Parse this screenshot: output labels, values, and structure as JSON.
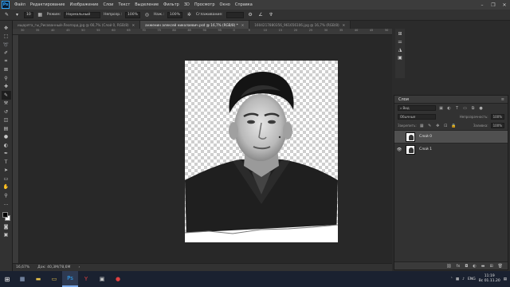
{
  "menu": {
    "logo": "Ps",
    "items": [
      "Файл",
      "Редактирование",
      "Изображение",
      "Слои",
      "Текст",
      "Выделение",
      "Фильтр",
      "3D",
      "Просмотр",
      "Окно",
      "Справка"
    ]
  },
  "options": {
    "brush_size": "10",
    "mode_label": "Режим:",
    "mode_value": "Нормальный",
    "opacity_label": "Непрозр.:",
    "opacity_value": "100%",
    "flow_label": "Наж.:",
    "flow_value": "100%",
    "smoothing_label": "Сглаживание:"
  },
  "tabs": [
    {
      "label": "ищарята_гы_Рисованный-Леопард.jpg @ 66,7% (Слой 0, RGB/8)",
      "active": false
    },
    {
      "label": "анженин алексей николаевич.psd @ 16,7% (RGB/8) *",
      "active": true
    },
    {
      "label": "1604217880356_961656106.jpg @ 16,7% (RGB/8)",
      "active": false
    }
  ],
  "ruler_marks": [
    "30",
    "35",
    "40",
    "45",
    "50",
    "55",
    "60",
    "65",
    "70",
    "75",
    "80",
    "85",
    "90",
    "95",
    "0",
    "5",
    "10",
    "15",
    "20",
    "25",
    "30",
    "35",
    "40",
    "45",
    "50"
  ],
  "status": {
    "zoom": "16,67%",
    "doc_size": "Док: 40,3M/78,6M"
  },
  "layers_panel": {
    "title": "Слои",
    "filter_kind": "Вид",
    "blend_mode": "Обычные",
    "opacity_label": "Непрозрачность:",
    "opacity_value": "100%",
    "lock_label": "Закрепить:",
    "fill_label": "Заливка:",
    "fill_value": "100%",
    "layers": [
      {
        "name": "Слой 0",
        "visible": false,
        "selected": true
      },
      {
        "name": "Слой 1",
        "visible": true,
        "selected": false
      }
    ]
  },
  "taskbar": {
    "lang": "ENG",
    "time": "11:19",
    "date": "Вс 01.11.20"
  },
  "colors": {
    "accent": "#31a8ff",
    "ui_dark": "#282828",
    "panel": "#323232",
    "selected_layer": "#505050"
  }
}
